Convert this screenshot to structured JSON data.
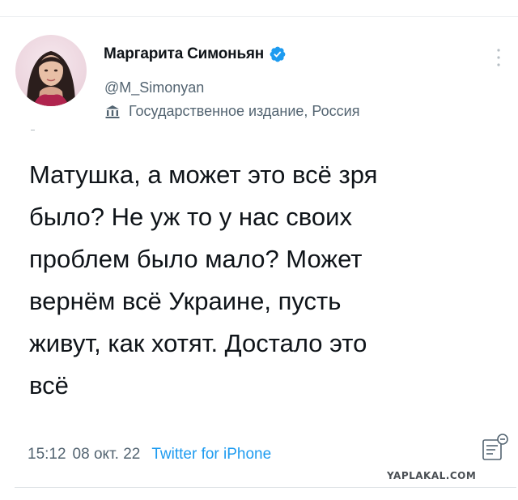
{
  "profile": {
    "name": "Маргарита Симоньян",
    "handle": "@M_Simonyan",
    "label": "Государственное издание, Россия",
    "verified": true,
    "verified_color": "#1d9bf0"
  },
  "icons": {
    "avatar": "profile-photo",
    "verified": "verified-badge-icon",
    "label": "government-building-icon",
    "more": "more-vertical-icon",
    "analytics": "tweet-analytics-icon"
  },
  "tweet": {
    "text": "Матушка, а может это всё зря\nбыло? Не уж то у нас своих\nпроблем было мало? Может\nвернём всё Украине, пусть\nживут, как хотят. Достало это\nвсё",
    "time": "15:12",
    "date": "08 окт. 22",
    "source": "Twitter for iPhone"
  },
  "watermark": "YAPLAKAL.COM",
  "colors": {
    "text": "#0f1419",
    "secondary": "#536471",
    "link": "#1d9bf0"
  }
}
